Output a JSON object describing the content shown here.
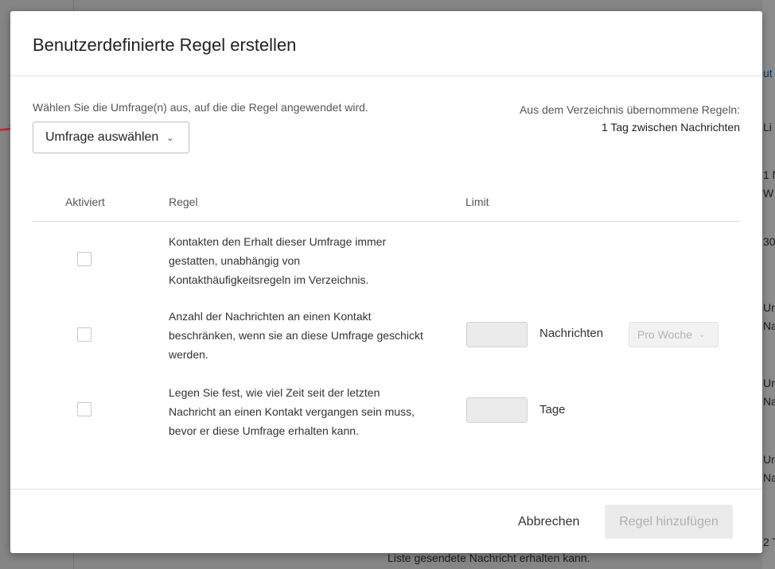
{
  "background": {
    "right_items": [
      "ut",
      "Li",
      "1 N",
      "W",
      "30",
      "Ur",
      "Na",
      "Ur",
      "Na",
      "Ur",
      "Na",
      "2 T"
    ],
    "bottom_text": "Liste gesendete Nachricht erhalten kann."
  },
  "modal": {
    "title": "Benutzerdefinierte Regel erstellen",
    "survey_label": "Wählen Sie die Umfrage(n) aus, auf die die Regel angewendet wird.",
    "survey_select": "Umfrage auswählen",
    "inherited_title": "Aus dem Verzeichnis übernommene Regeln:",
    "inherited_value": "1 Tag zwischen Nachrichten",
    "table": {
      "headers": {
        "enabled": "Aktiviert",
        "rule": "Regel",
        "limit": "Limit"
      },
      "rows": [
        {
          "text": "Kontakten den Erhalt dieser Umfrage immer gestatten, unabhängig von Kontakthäufigkeitsregeln im Verzeichnis.",
          "checked": false
        },
        {
          "text": "Anzahl der Nachrichten an einen Kontakt beschränken, wenn sie an diese Umfrage geschickt werden.",
          "checked": false,
          "unit": "Nachrichten",
          "period": "Pro Woche"
        },
        {
          "text": "Legen Sie fest, wie viel Zeit seit der letzten Nachricht an einen Kontakt vergangen sein muss, bevor er diese Umfrage erhalten kann.",
          "checked": false,
          "unit": "Tage"
        }
      ]
    },
    "buttons": {
      "cancel": "Abbrechen",
      "add": "Regel hinzufügen"
    }
  },
  "colors": {
    "annotation_arrow": "#c0213a",
    "disabled_text": "#b0b0b0"
  }
}
